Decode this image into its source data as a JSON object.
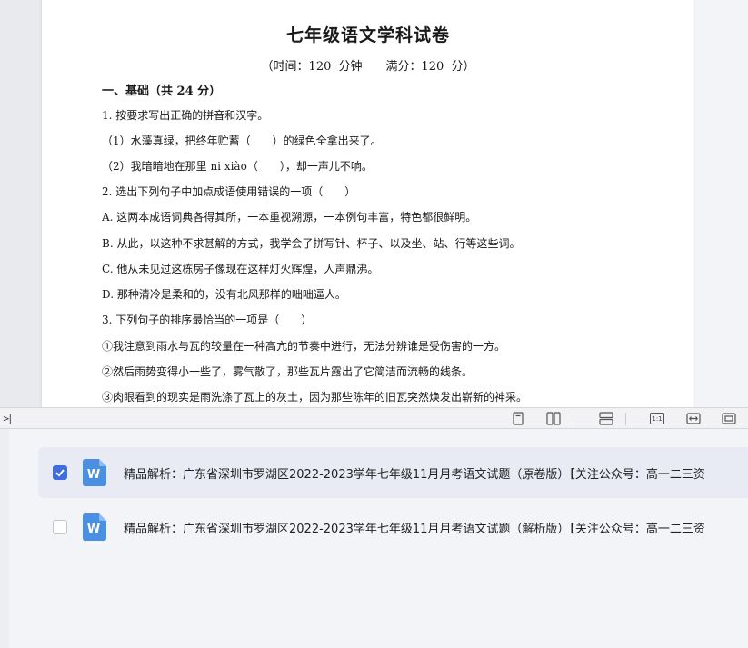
{
  "document": {
    "title": "七年级语文学科试卷",
    "subtitle": "（时间：120 分钟　　满分：120 分）",
    "lines": [
      "一、基础（共 24 分）",
      "1. 按要求写出正确的拼音和汉字。",
      "（1）水藻真绿，把终年贮蓄（　　）的绿色全拿出来了。",
      "（2）我暗暗地在那里 ni xiào（　　），却一声儿不响。",
      "2. 选出下列句子中加点成语使用错误的一项（　　）",
      "A. 这两本成语词典各得其所，一本重视溯源，一本例句丰富，特色都很鲜明。",
      "B. 从此，以这种不求甚解的方式，我学会了拼写针、杯子、以及坐、站、行等这些词。",
      "C. 他从未见过这栋房子像现在这样灯火辉煌，人声鼎沸。",
      "D. 那种清冷是柔和的，没有北风那样的咄咄逼人。",
      "3. 下列句子的排序最恰当的一项是（　　）",
      "①我注意到雨水与瓦的较量在一种高亢的节奏中进行，无法分辨谁是受伤害的一方。",
      "②然后雨势变得小一些了，雾气散了，那些瓦片露出了它简洁而流畅的线条。",
      "③肉眼看到的现实是雨洗涤了瓦上的灰土，因为那些陈年的旧瓦突然焕发出崭新的神采。"
    ]
  },
  "toolbar": {
    "collapse_glyph": ">|",
    "buttons": [
      "single-page-view",
      "two-page-view",
      "continuous-view",
      "actual-size",
      "fit-width",
      "fit-page"
    ],
    "actual_size_label": "1:1"
  },
  "files": [
    {
      "name": "精品解析：广东省深圳市罗湖区2022-2023学年七年级11月月考语文试题（原卷版）【关注公众号：高一二三资",
      "checked": true,
      "icon": "word-doc-icon"
    },
    {
      "name": "精品解析：广东省深圳市罗湖区2022-2023学年七年级11月月考语文试题（解析版）【关注公众号：高一二三资",
      "checked": false,
      "icon": "word-doc-icon"
    }
  ],
  "colors": {
    "accent": "#3f6ddc",
    "word_icon": "#4a90e2",
    "selected_row": "#e8ebf3"
  }
}
